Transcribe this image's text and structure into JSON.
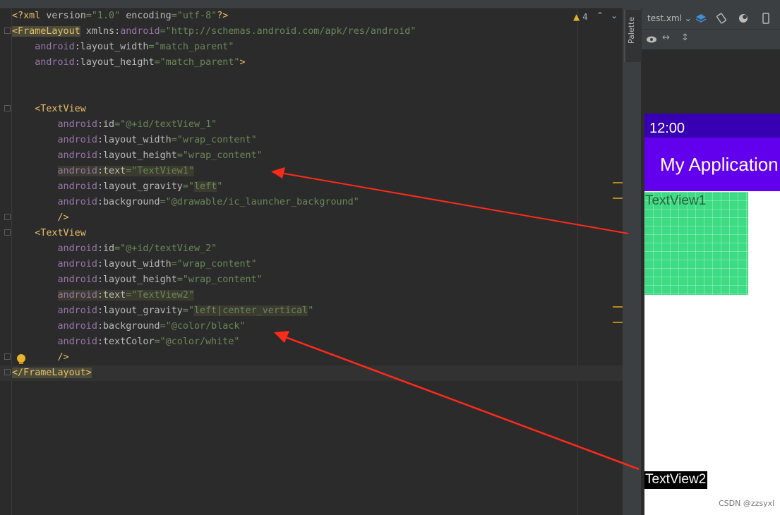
{
  "editor": {
    "lines": [
      {
        "parts": [
          [
            "tag",
            "<?xml "
          ],
          [
            "attr",
            "version"
          ],
          [
            "val",
            "=\"1.0\" "
          ],
          [
            "attr",
            "encoding"
          ],
          [
            "val",
            "=\"utf-8\""
          ],
          [
            "tag",
            "?>"
          ]
        ]
      },
      {
        "parts": [
          [
            "tag hl2",
            "<FrameLayout"
          ],
          [
            "attr",
            " xmlns:"
          ],
          [
            "ns",
            "android"
          ],
          [
            "val",
            "=\"http://schemas.android.com/apk/res/android\""
          ]
        ]
      },
      {
        "parts": [
          [
            "attr",
            "    "
          ],
          [
            "ns",
            "android"
          ],
          [
            "attr",
            ":layout_width"
          ],
          [
            "val",
            "=\"match_parent\""
          ]
        ]
      },
      {
        "parts": [
          [
            "attr",
            "    "
          ],
          [
            "ns",
            "android"
          ],
          [
            "attr",
            ":layout_height"
          ],
          [
            "val",
            "=\"match_parent\""
          ],
          [
            "tag",
            ">"
          ]
        ]
      },
      {
        "parts": []
      },
      {
        "parts": []
      },
      {
        "parts": [
          [
            "attr",
            "    "
          ],
          [
            "tag",
            "<TextView"
          ]
        ]
      },
      {
        "parts": [
          [
            "attr",
            "        "
          ],
          [
            "ns",
            "android"
          ],
          [
            "attr",
            ":id"
          ],
          [
            "val",
            "=\"@+id/textView_1\""
          ]
        ]
      },
      {
        "parts": [
          [
            "attr",
            "        "
          ],
          [
            "ns",
            "android"
          ],
          [
            "attr",
            ":layout_width"
          ],
          [
            "val",
            "=\"wrap_content\""
          ]
        ]
      },
      {
        "parts": [
          [
            "attr",
            "        "
          ],
          [
            "ns",
            "android"
          ],
          [
            "attr",
            ":layout_height"
          ],
          [
            "val",
            "=\"wrap_content\""
          ]
        ]
      },
      {
        "parts": [
          [
            "attr",
            "        "
          ],
          [
            "ns hl",
            "android"
          ],
          [
            "attr hl",
            ":text"
          ],
          [
            "val hl",
            "=\"TextView1\""
          ]
        ]
      },
      {
        "parts": [
          [
            "attr",
            "        "
          ],
          [
            "ns",
            "android"
          ],
          [
            "attr",
            ":layout_gravity"
          ],
          [
            "val",
            "=\""
          ],
          [
            "val hl",
            "left"
          ],
          [
            "val",
            "\""
          ]
        ]
      },
      {
        "parts": [
          [
            "attr",
            "        "
          ],
          [
            "ns",
            "android"
          ],
          [
            "attr",
            ":background"
          ],
          [
            "val",
            "=\"@drawable/ic_launcher_background\""
          ]
        ]
      },
      {
        "parts": [
          [
            "attr",
            "        "
          ],
          [
            "tag",
            "/>"
          ]
        ]
      },
      {
        "parts": [
          [
            "attr",
            "    "
          ],
          [
            "tag",
            "<TextView"
          ]
        ]
      },
      {
        "parts": [
          [
            "attr",
            "        "
          ],
          [
            "ns",
            "android"
          ],
          [
            "attr",
            ":id"
          ],
          [
            "val",
            "=\"@+id/textView_2\""
          ]
        ]
      },
      {
        "parts": [
          [
            "attr",
            "        "
          ],
          [
            "ns",
            "android"
          ],
          [
            "attr",
            ":layout_width"
          ],
          [
            "val",
            "=\"wrap_content\""
          ]
        ]
      },
      {
        "parts": [
          [
            "attr",
            "        "
          ],
          [
            "ns",
            "android"
          ],
          [
            "attr",
            ":layout_height"
          ],
          [
            "val",
            "=\"wrap_content\""
          ]
        ]
      },
      {
        "parts": [
          [
            "attr",
            "        "
          ],
          [
            "ns hl",
            "android"
          ],
          [
            "attr hl",
            ":text"
          ],
          [
            "val hl",
            "=\"TextView2\""
          ]
        ]
      },
      {
        "parts": [
          [
            "attr",
            "        "
          ],
          [
            "ns",
            "android"
          ],
          [
            "attr",
            ":layout_gravity"
          ],
          [
            "val",
            "=\""
          ],
          [
            "val hl",
            "left|center_vertical"
          ],
          [
            "val",
            "\""
          ]
        ]
      },
      {
        "parts": [
          [
            "attr",
            "        "
          ],
          [
            "ns",
            "android"
          ],
          [
            "attr",
            ":background"
          ],
          [
            "val",
            "=\"@color/black\""
          ]
        ]
      },
      {
        "parts": [
          [
            "attr",
            "        "
          ],
          [
            "ns",
            "android"
          ],
          [
            "attr",
            ":textColor"
          ],
          [
            "val",
            "=\"@color/white\""
          ]
        ]
      },
      {
        "parts": [
          [
            "attr",
            "        "
          ],
          [
            "tag",
            "/>"
          ]
        ]
      },
      {
        "parts": [
          [
            "tag hl2",
            "</FrameLayout>"
          ]
        ]
      }
    ],
    "warnings_count": "4"
  },
  "design": {
    "file_tab": "test.xml",
    "palette_label": "Palette",
    "status_time": "12:00",
    "app_title": "My Application",
    "textview1": "TextView1",
    "textview2": "TextView2"
  },
  "watermark": "CSDN @zzsyxl",
  "colors": {
    "status_bar": "#3700b3",
    "app_bar": "#6200ee",
    "launcher_green": "#3ddc84",
    "arrow": "#ff2a1a"
  }
}
